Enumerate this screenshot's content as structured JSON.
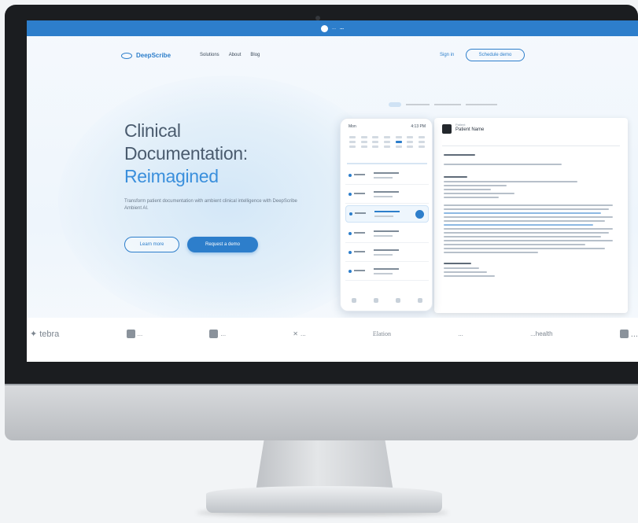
{
  "banner": {
    "text": "...",
    "link_text": "..."
  },
  "nav": {
    "brand": "DeepScribe",
    "menu": [
      "Solutions",
      "About",
      "Blog"
    ],
    "sign_in": "Sign in",
    "cta": "Schedule demo"
  },
  "hero": {
    "title_line1": "Clinical",
    "title_line2": "Documentation:",
    "title_line3": "Reimagined",
    "subtitle": "Transform patient documentation with ambient clinical intelligence with DeepScribe Ambient AI.",
    "primary_button": "Learn more",
    "secondary_button": "Request a demo"
  },
  "phone": {
    "header_left": "Mon",
    "header_right": "4:13 PM"
  },
  "doc": {
    "pre_label": "Patient",
    "patient_name": "Patient Name"
  },
  "logos": [
    {
      "name": "tebra",
      "icon": "leaf-icon"
    },
    {
      "name": "...",
      "icon": "building-icon"
    },
    {
      "name": "...",
      "icon": "square-icon"
    },
    {
      "name": "...",
      "icon": "caduceus-icon"
    },
    {
      "name": "Elation",
      "icon": ""
    },
    {
      "name": "...",
      "icon": ""
    },
    {
      "name": "...health",
      "icon": ""
    },
    {
      "name": "...",
      "icon": "square-icon"
    }
  ],
  "colors": {
    "accent": "#2d7ecb",
    "title": "#4a5b6e",
    "title_accent": "#3a8fdc",
    "bezel": "#1b1d20"
  }
}
